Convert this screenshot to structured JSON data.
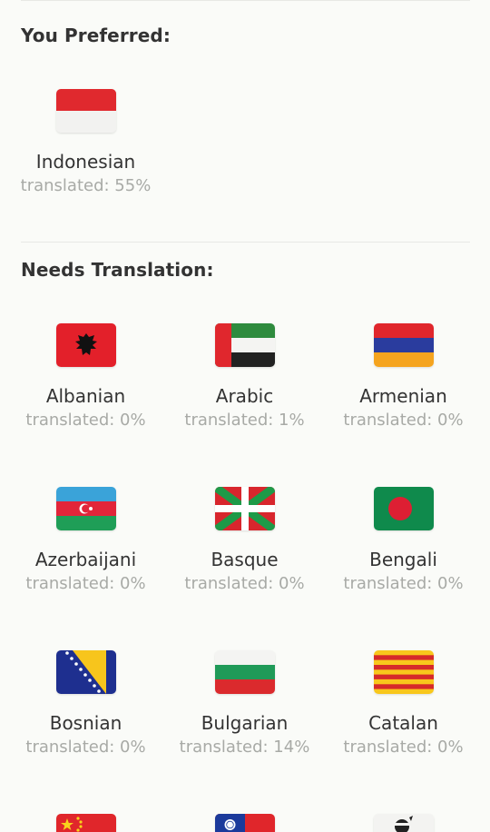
{
  "preferred": {
    "title": "You Preferred:",
    "items": [
      {
        "name": "Indonesian",
        "stat": "translated: 55%",
        "flag": "indonesia-flag-icon"
      }
    ]
  },
  "needs": {
    "title": "Needs Translation:",
    "items": [
      {
        "name": "Albanian",
        "stat": "translated: 0%",
        "flag": "albania-flag-icon"
      },
      {
        "name": "Arabic",
        "stat": "translated: 1%",
        "flag": "uae-flag-icon"
      },
      {
        "name": "Armenian",
        "stat": "translated: 0%",
        "flag": "armenia-flag-icon"
      },
      {
        "name": "Azerbaijani",
        "stat": "translated: 0%",
        "flag": "azerbaijan-flag-icon"
      },
      {
        "name": "Basque",
        "stat": "translated: 0%",
        "flag": "basque-flag-icon"
      },
      {
        "name": "Bengali",
        "stat": "translated: 0%",
        "flag": "bangladesh-flag-icon"
      },
      {
        "name": "Bosnian",
        "stat": "translated: 0%",
        "flag": "bosnia-flag-icon"
      },
      {
        "name": "Bulgarian",
        "stat": "translated: 14%",
        "flag": "bulgaria-flag-icon"
      },
      {
        "name": "Catalan",
        "stat": "translated: 0%",
        "flag": "catalonia-flag-icon"
      },
      {
        "flag": "china-flag-icon"
      },
      {
        "flag": "taiwan-flag-icon"
      },
      {
        "flag": "corsica-flag-icon"
      }
    ]
  }
}
